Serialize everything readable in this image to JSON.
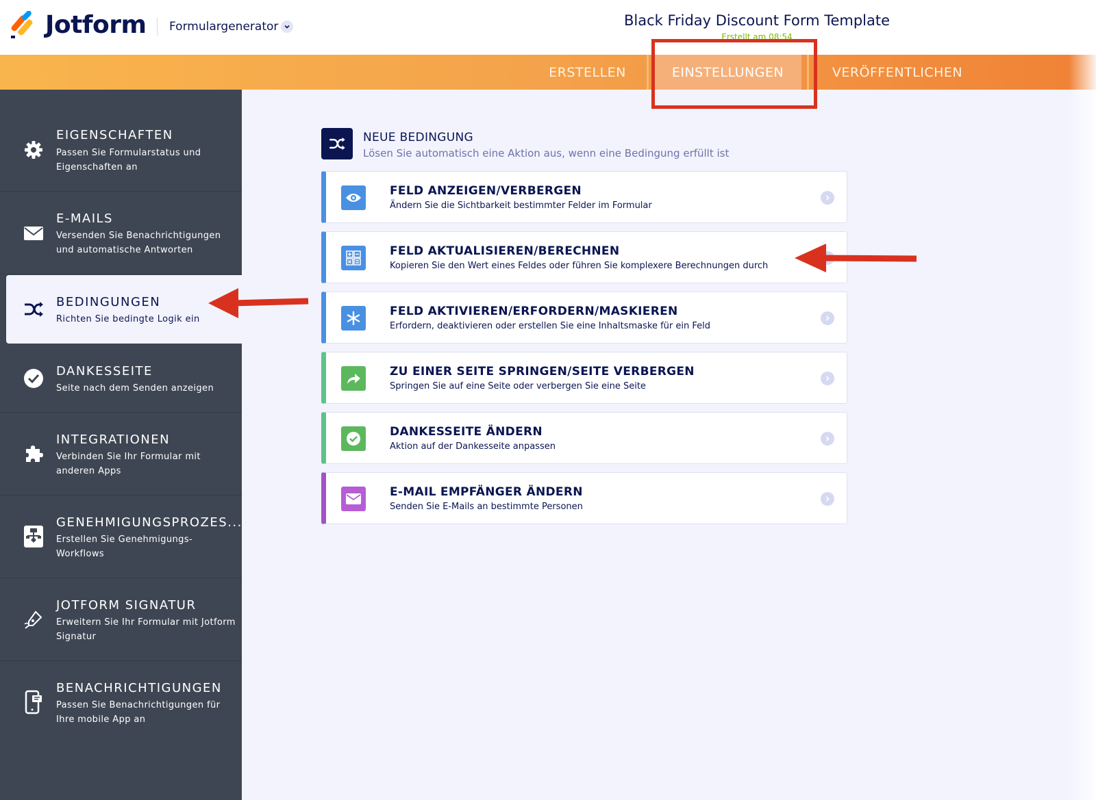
{
  "header": {
    "logo_text": "Jotform",
    "builder_label": "Formulargenerator",
    "form_title": "Black Friday Discount Form Template",
    "form_subtitle": "Erstellt am 08:54"
  },
  "nav": {
    "tabs": [
      {
        "label": "ERSTELLEN",
        "active": false
      },
      {
        "label": "EINSTELLUNGEN",
        "active": true
      },
      {
        "label": "VERÖFFENTLICHEN",
        "active": false
      }
    ]
  },
  "sidebar": {
    "items": [
      {
        "title": "EIGENSCHAFTEN",
        "desc": "Passen Sie Formularstatus und Eigenschaften an",
        "icon": "gear-icon"
      },
      {
        "title": "E-MAILS",
        "desc": "Versenden Sie Benachrichtigungen und automatische Antworten",
        "icon": "envelope-icon"
      },
      {
        "title": "BEDINGUNGEN",
        "desc": "Richten Sie bedingte Logik ein",
        "icon": "shuffle-icon",
        "active": true
      },
      {
        "title": "DANKESSEITE",
        "desc": "Seite nach dem Senden anzeigen",
        "icon": "check-circle-icon"
      },
      {
        "title": "INTEGRATIONEN",
        "desc": "Verbinden Sie Ihr Formular mit anderen Apps",
        "icon": "puzzle-icon"
      },
      {
        "title": "GENEHMIGUNGSPROZES...",
        "desc": "Erstellen Sie Genehmigungs-Workflows",
        "icon": "workflow-icon"
      },
      {
        "title": "JOTFORM SIGNATUR",
        "desc": "Erweitern Sie Ihr Formular mit Jotform Signatur",
        "icon": "pen-icon"
      },
      {
        "title": "BENACHRICHTIGUNGEN",
        "desc": "Passen Sie Benachrichtigungen für Ihre mobile App an",
        "icon": "mobile-icon"
      }
    ]
  },
  "main": {
    "header_title": "NEUE BEDINGUNG",
    "header_subtitle": "Lösen Sie automatisch eine Aktion aus, wenn eine Bedingung erfüllt ist",
    "cards": [
      {
        "title": "FELD ANZEIGEN/VERBERGEN",
        "desc": "Ändern Sie die Sichtbarkeit bestimmter Felder im Formular",
        "icon": "eye-icon",
        "color": "#4a90e2"
      },
      {
        "title": "FELD AKTUALISIEREN/BERECHNEN",
        "desc": "Kopieren Sie den Wert eines Feldes oder führen Sie komplexere Berechnungen durch",
        "icon": "calculator-icon",
        "color": "#4a90e2"
      },
      {
        "title": "FELD AKTIVIEREN/ERFORDERN/MASKIEREN",
        "desc": "Erfordern, deaktivieren oder erstellen Sie eine Inhaltsmaske für ein Feld",
        "icon": "asterisk-icon",
        "color": "#4a90e2"
      },
      {
        "title": "ZU EINER SEITE SPRINGEN/SEITE VERBERGEN",
        "desc": "Springen Sie auf eine Seite oder verbergen Sie eine Seite",
        "icon": "share-arrow-icon",
        "color": "#5ac489"
      },
      {
        "title": "DANKESSEITE ÄNDERN",
        "desc": "Aktion auf der Dankesseite anpassen",
        "icon": "check-circle-icon",
        "color": "#5ac489"
      },
      {
        "title": "E-MAIL EMPFÄNGER ÄNDERN",
        "desc": "Senden Sie E-Mails an bestimmte Personen",
        "icon": "envelope-icon",
        "color": "#a253c7"
      }
    ]
  },
  "colors": {
    "brand_navy": "#0a1551",
    "nav_orange": "#f4a24b",
    "sidebar_bg": "#3f4653",
    "annotation_red": "#d8321f"
  }
}
